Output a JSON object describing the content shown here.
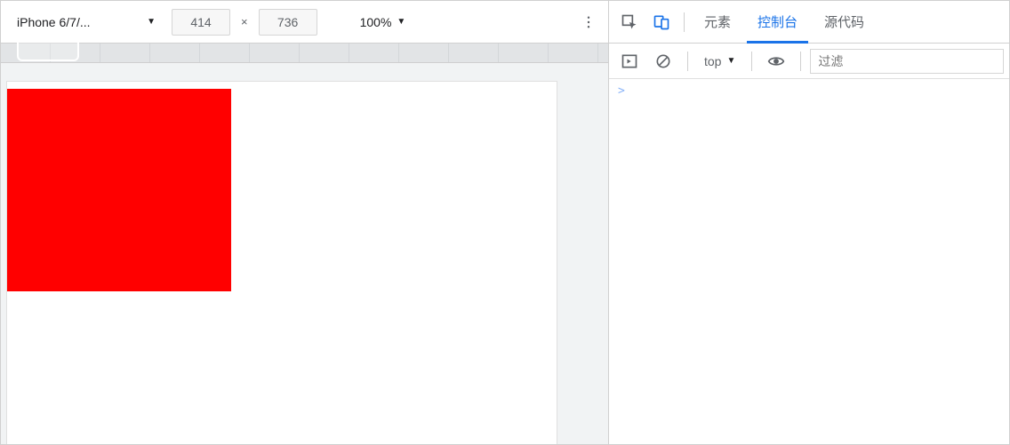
{
  "device_toolbar": {
    "device_name": "iPhone 6/7/...",
    "width": "414",
    "height": "736",
    "dim_separator": "×",
    "zoom": "100%"
  },
  "viewport": {
    "red_box_color": "#ff0000"
  },
  "devtools": {
    "tabs": {
      "elements": "元素",
      "console": "控制台",
      "sources": "源代码"
    },
    "console_toolbar": {
      "scope": "top",
      "filter_placeholder": "过滤"
    },
    "console": {
      "prompt": ">"
    }
  }
}
